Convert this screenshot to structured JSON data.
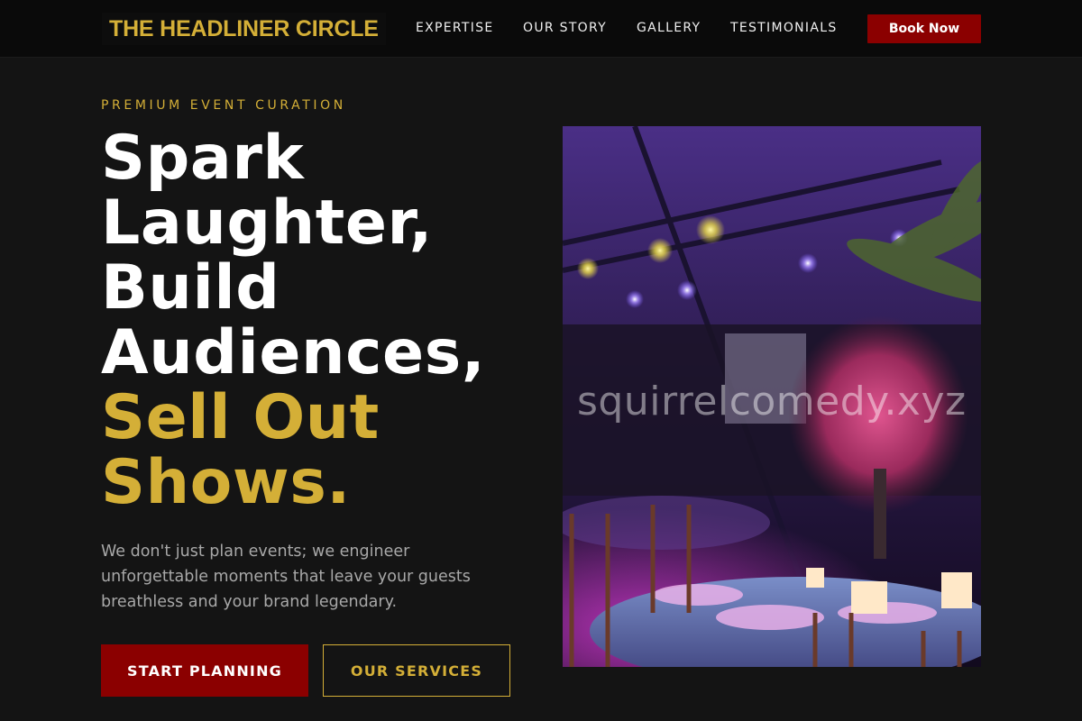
{
  "brand": {
    "name": "THE HEADLINER CIRCLE"
  },
  "nav": {
    "items": [
      {
        "label": "EXPERTISE"
      },
      {
        "label": "OUR STORY"
      },
      {
        "label": "GALLERY"
      },
      {
        "label": "TESTIMONIALS"
      }
    ],
    "book_label": "Book Now"
  },
  "hero": {
    "eyebrow": "PREMIUM EVENT CURATION",
    "headline_lines": [
      "Spark",
      "Laughter,",
      "Build",
      "Audiences,"
    ],
    "headline_accent_lines": [
      "Sell Out",
      "Shows."
    ],
    "lede": "We don't just plan events; we engineer unforgettable moments that leave your guests breathless and your brand legendary.",
    "primary_cta": "START PLANNING",
    "secondary_cta": "OUR SERVICES",
    "image_watermark": "squirrelcomedy.xyz"
  },
  "colors": {
    "accent_gold": "#d4af37",
    "accent_red": "#8b0000",
    "background": "#141414"
  }
}
